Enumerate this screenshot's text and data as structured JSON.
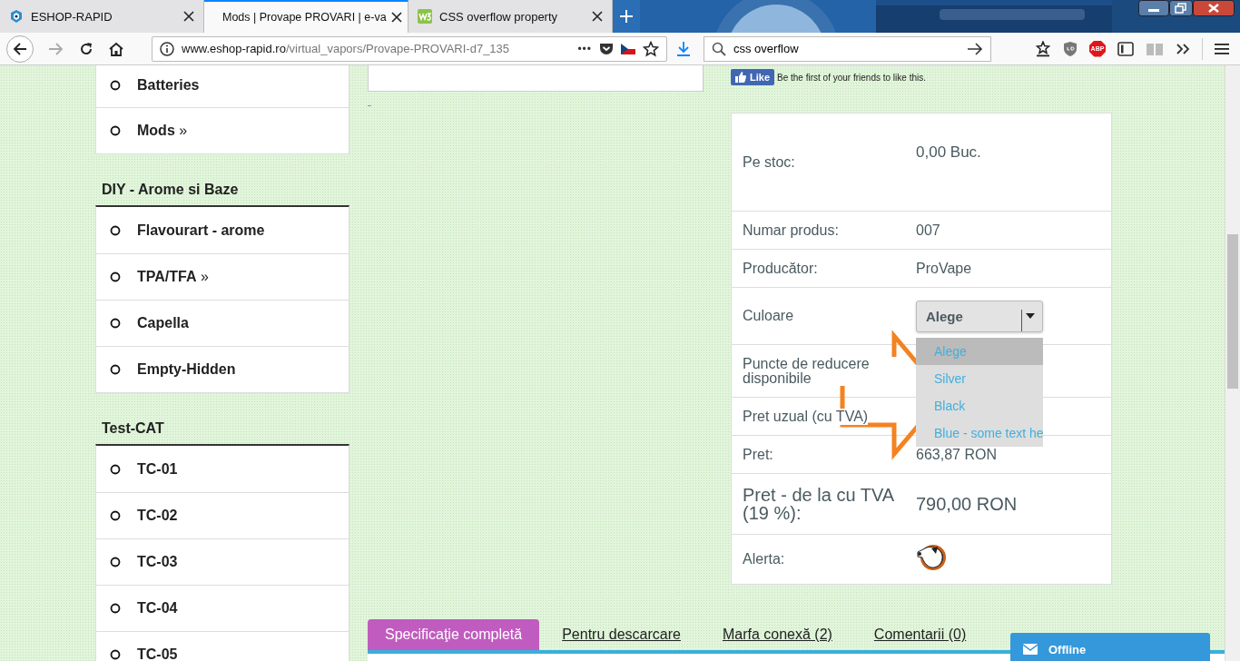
{
  "browser": {
    "tabs": [
      {
        "title": "ESHOP-RAPID",
        "selected": false
      },
      {
        "title": "Mods | Provape PROVARI | e-va",
        "selected": true
      },
      {
        "title": "CSS overflow property",
        "selected": false
      }
    ],
    "address": {
      "domain": "www.eshop-rapid.ro",
      "path": "/virtual_vapors/Provape-PROVARI-d7_135",
      "more": "•••"
    },
    "search": {
      "value": "css overflow"
    },
    "abp_label": "ABP"
  },
  "sidebar": {
    "groups": [
      {
        "items": [
          {
            "label": "Batteries"
          },
          {
            "label": "Mods",
            "suffix": "»"
          }
        ]
      },
      {
        "heading": "DIY - Arome si Baze",
        "items": [
          {
            "label": "Flavourart - arome"
          },
          {
            "label": "TPA/TFA",
            "suffix": "»"
          },
          {
            "label": "Capella"
          },
          {
            "label": "Empty-Hidden"
          }
        ]
      },
      {
        "heading": "Test-CAT",
        "items": [
          {
            "label": "TC-01"
          },
          {
            "label": "TC-02"
          },
          {
            "label": "TC-03"
          },
          {
            "label": "TC-04"
          },
          {
            "label": "TC-05"
          }
        ]
      }
    ]
  },
  "like": {
    "button": "Like",
    "text": "Be the first of your friends to like this."
  },
  "details": [
    {
      "kind": "stock",
      "label": "Pe stoc:",
      "value": "0,00 Buc."
    },
    {
      "kind": "text",
      "label": "Numar produs:",
      "value": "007"
    },
    {
      "kind": "text",
      "label": "Producător:",
      "value": "ProVape"
    },
    {
      "kind": "select",
      "label": "Culoare",
      "value": "Alege",
      "open": true,
      "options": [
        {
          "label": "Alege",
          "selected": true
        },
        {
          "label": "Silver",
          "selected": false
        },
        {
          "label": "Black",
          "selected": false
        },
        {
          "label": "Blue - some text he",
          "selected": false
        }
      ]
    },
    {
      "kind": "wrap",
      "label": "Puncte de reducere disponibile"
    },
    {
      "kind": "text",
      "label": "Pret uzual (cu TVA)"
    },
    {
      "kind": "text",
      "label": "Pret:",
      "value": "663,87 RON"
    },
    {
      "kind": "total",
      "label": "Pret - de la cu TVA (19 %):",
      "value": "790,00 RON"
    },
    {
      "kind": "icon",
      "label": "Alerta:"
    }
  ],
  "product_tabs": [
    {
      "label": "Specificaţie completă",
      "selected": true
    },
    {
      "label": "Pentru descarcare",
      "selected": false
    },
    {
      "label": "Marfa conexă (2)",
      "selected": false
    },
    {
      "label": "Comentarii (0)",
      "selected": false
    }
  ],
  "chat": {
    "label": "Offline"
  }
}
